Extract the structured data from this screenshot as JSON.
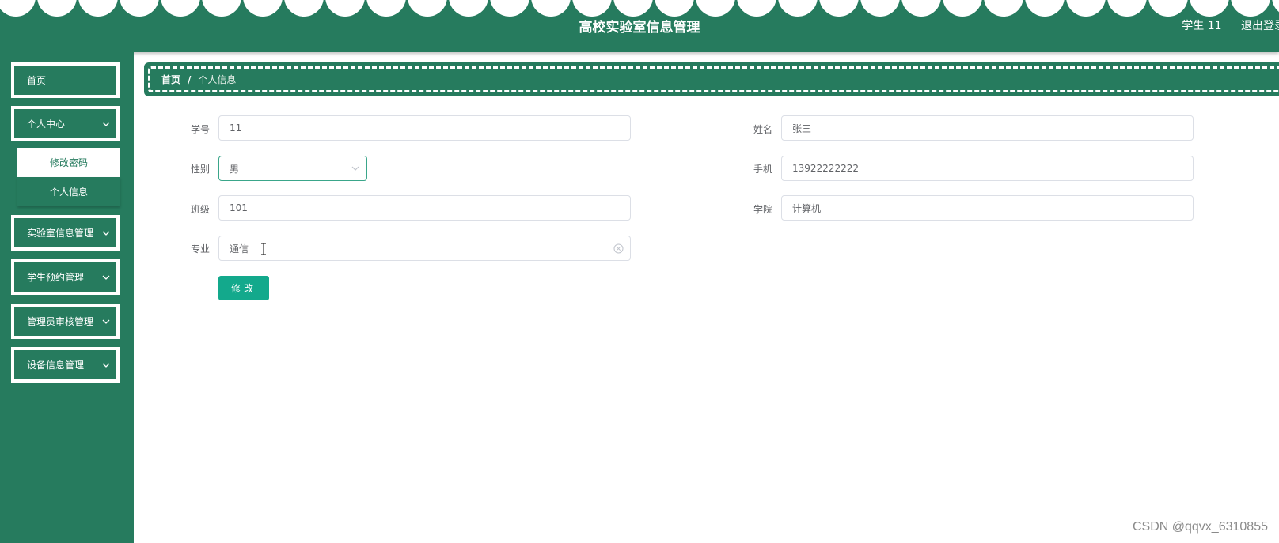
{
  "header": {
    "title": "高校实验室信息管理",
    "user_label": "学生 11",
    "logout_label": "退出登录"
  },
  "sidebar": {
    "items": [
      {
        "label": "首页"
      },
      {
        "label": "个人中心"
      },
      {
        "label": "实验室信息管理"
      },
      {
        "label": "学生预约管理"
      },
      {
        "label": "管理员审核管理"
      },
      {
        "label": "设备信息管理"
      }
    ],
    "personal_submenu": [
      {
        "label": "修改密码",
        "active": true
      },
      {
        "label": "个人信息",
        "active": false
      }
    ]
  },
  "breadcrumb": {
    "home": "首页",
    "separator": "/",
    "current": "个人信息"
  },
  "form": {
    "student_id": {
      "label": "学号",
      "value": "11"
    },
    "name": {
      "label": "姓名",
      "value": "张三"
    },
    "gender": {
      "label": "性别",
      "value": "男"
    },
    "phone": {
      "label": "手机",
      "value": "13922222222"
    },
    "class": {
      "label": "班级",
      "value": "101"
    },
    "college": {
      "label": "学院",
      "value": "计算机"
    },
    "major": {
      "label": "专业",
      "value": "通信"
    },
    "submit_label": "修改"
  },
  "watermark": "CSDN @qqvx_6310855",
  "colors": {
    "brand_green": "#267b5e",
    "button_teal": "#13a98c",
    "select_border": "#3aa68a"
  }
}
